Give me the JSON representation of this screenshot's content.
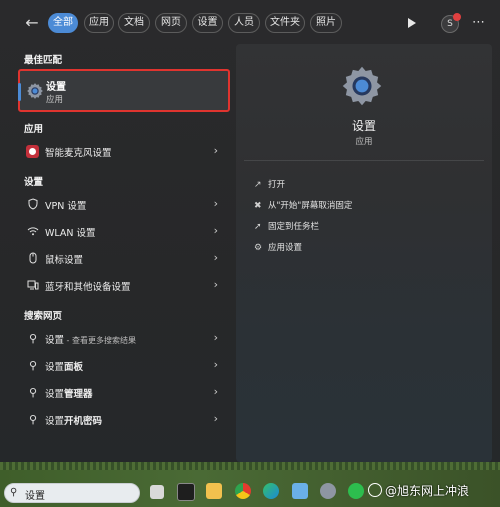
{
  "filters": [
    "全部",
    "应用",
    "文档",
    "网页",
    "设置",
    "人员",
    "文件夹",
    "照片"
  ],
  "active_filter": "全部",
  "avatar_letter": "S",
  "sections": {
    "best": "最佳匹配",
    "apps": "应用",
    "settings": "设置",
    "web": "搜索网页"
  },
  "best_match": {
    "title": "设置",
    "subtitle": "应用"
  },
  "apps": [
    {
      "label": "智能麦克风设置"
    }
  ],
  "settings_items": [
    {
      "label": "VPN 设置",
      "icon": "shield-icon"
    },
    {
      "label": "WLAN 设置",
      "icon": "wifi-icon"
    },
    {
      "label": "鼠标设置",
      "icon": "mouse-icon"
    },
    {
      "label": "蓝牙和其他设备设置",
      "icon": "bluetooth-icon"
    }
  ],
  "web_items": [
    {
      "label": "设置",
      "suffix": " - 查看更多搜索结果"
    },
    {
      "label": "设置",
      "bold": "面板"
    },
    {
      "label": "设置",
      "bold": "管理器"
    },
    {
      "label": "设置",
      "bold": "开机密码"
    }
  ],
  "detail": {
    "title": "设置",
    "subtitle": "应用",
    "actions": [
      {
        "label": "打开",
        "icon": "open-icon"
      },
      {
        "label": "从\"开始\"屏幕取消固定",
        "icon": "unpin-icon"
      },
      {
        "label": "固定到任务栏",
        "icon": "pin-icon"
      },
      {
        "label": "应用设置",
        "icon": "gear-icon"
      }
    ]
  },
  "taskbar": {
    "search_text": "设置"
  },
  "watermark": "@旭东网上冲浪",
  "colors": {
    "accent": "#4c8bd6",
    "highlight_border": "#e0342f"
  }
}
